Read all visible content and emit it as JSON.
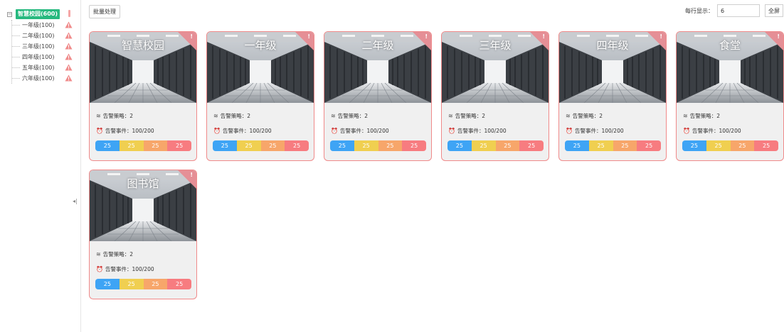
{
  "toolbar": {
    "batch_label": "批量处理",
    "per_row_label": "每行显示：",
    "per_row_value": "6",
    "fullscreen_label": "全屏"
  },
  "tree": {
    "root": "智慧校园(600)",
    "children": [
      "一年级(100)",
      "二年级(100)",
      "三年级(100)",
      "四年级(100)",
      "五年级(100)",
      "六年级(100)"
    ]
  },
  "cards": [
    {
      "title": "智慧校园",
      "strategy": "告警策略：2",
      "events": "告警事件：100/200",
      "counts": [
        "25",
        "25",
        "25",
        "25"
      ]
    },
    {
      "title": "一年级",
      "strategy": "告警策略：2",
      "events": "告警事件：100/200",
      "counts": [
        "25",
        "25",
        "25",
        "25"
      ]
    },
    {
      "title": "二年级",
      "strategy": "告警策略：2",
      "events": "告警事件：100/200",
      "counts": [
        "25",
        "25",
        "25",
        "25"
      ]
    },
    {
      "title": "三年级",
      "strategy": "告警策略：2",
      "events": "告警事件：100/200",
      "counts": [
        "25",
        "25",
        "25",
        "25"
      ]
    },
    {
      "title": "四年级",
      "strategy": "告警策略：2",
      "events": "告警事件：100/200",
      "counts": [
        "25",
        "25",
        "25",
        "25"
      ]
    },
    {
      "title": "食堂",
      "strategy": "告警策略：2",
      "events": "告警事件：100/200",
      "counts": [
        "25",
        "25",
        "25",
        "25"
      ]
    },
    {
      "title": "图书馆",
      "strategy": "告警策略：2",
      "events": "告警事件：100/200",
      "counts": [
        "25",
        "25",
        "25",
        "25"
      ]
    }
  ],
  "colors": {
    "tree_selected": "#27b97f",
    "card_border": "#f08a8a",
    "warning": "#f08a8a",
    "segment_blue": "#3ea4f5",
    "segment_yellow": "#f0cf50",
    "segment_orange": "#f7a66a",
    "segment_red": "#f77c80"
  },
  "icons": {
    "strategy": "layers-icon",
    "events": "alarm-icon",
    "tree_warning": "warning-triangle-icon",
    "sidebar_toggle": "collapse-arrow-icon"
  }
}
